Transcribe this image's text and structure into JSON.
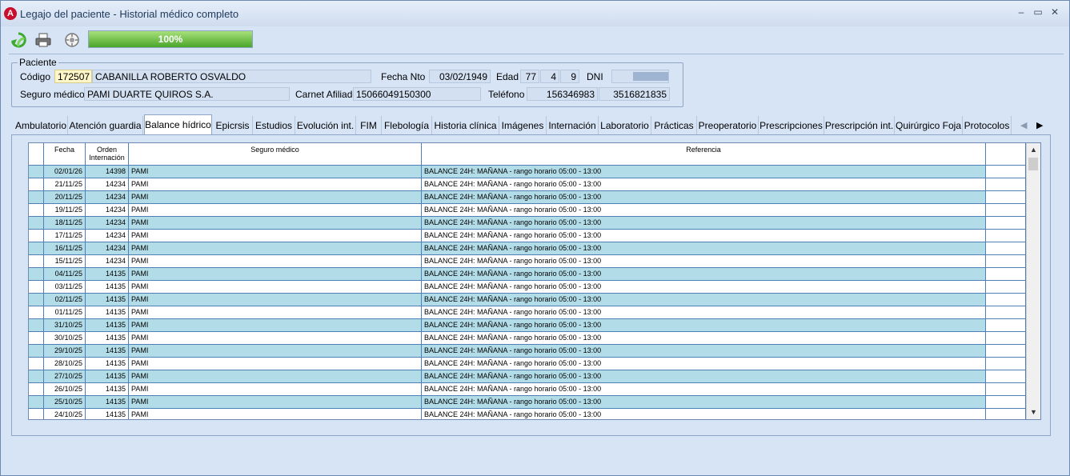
{
  "window": {
    "title": "Legajo del paciente - Historial médico completo",
    "app_icon_letter": "A",
    "minimize": "‒",
    "maximize": "▭",
    "close": "✕"
  },
  "toolbar": {
    "refresh_icon": "refresh-icon",
    "print_icon": "printer-icon",
    "tool_icon": "gear-icon",
    "progress_label": "100%",
    "progress_value": 1.0
  },
  "paciente": {
    "legend": "Paciente",
    "codigo_label": "Código",
    "codigo": "172507",
    "nombre": "CABANILLA ROBERTO OSVALDO",
    "fecha_nto_label": "Fecha Nto",
    "fecha_nto": "03/02/1949",
    "edad_label": "Edad",
    "edad_anios": "77",
    "edad_meses": "4",
    "edad_dias": "9",
    "dni_label": "DNI",
    "seguro_label": "Seguro médico",
    "seguro": "PAMI DUARTE QUIROS S.A.",
    "carnet_label": "Carnet Afiliado",
    "carnet": "15066049150300",
    "telefono_label": "Teléfono",
    "telefono1": "156346983",
    "telefono2": "3516821835"
  },
  "tabs": [
    "Ambulatorio",
    "Atención guardia",
    "Balance hídrico",
    "Epicrsis",
    "Estudios",
    "Evolución int.",
    "FIM",
    "Flebología",
    "Historia clínica",
    "Imágenes",
    "Internación",
    "Laboratorio",
    "Prácticas",
    "Preoperatorio",
    "Prescripciones",
    "Prescripción int.",
    "Quirúrgico Foja",
    "Protocolos"
  ],
  "tab_arrows": {
    "left": "◀",
    "right": "▶"
  },
  "grid": {
    "headers": {
      "fecha": "Fecha",
      "orden": "Orden Internación",
      "seguro": "Seguro médico",
      "referencia": "Referencia"
    },
    "rows": [
      {
        "fecha": "02/01/26",
        "orden": "14398",
        "seguro": "PAMI",
        "referencia": "BALANCE 24H: MAÑANA - rango horario 05:00 - 13:00"
      },
      {
        "fecha": "21/11/25",
        "orden": "14234",
        "seguro": "PAMI",
        "referencia": "BALANCE 24H: MAÑANA - rango horario 05:00 - 13:00"
      },
      {
        "fecha": "20/11/25",
        "orden": "14234",
        "seguro": "PAMI",
        "referencia": "BALANCE 24H: MAÑANA - rango horario 05:00 - 13:00"
      },
      {
        "fecha": "19/11/25",
        "orden": "14234",
        "seguro": "PAMI",
        "referencia": "BALANCE 24H: MAÑANA - rango horario 05:00 - 13:00"
      },
      {
        "fecha": "18/11/25",
        "orden": "14234",
        "seguro": "PAMI",
        "referencia": "BALANCE 24H: MAÑANA - rango horario 05:00 - 13:00"
      },
      {
        "fecha": "17/11/25",
        "orden": "14234",
        "seguro": "PAMI",
        "referencia": "BALANCE 24H: MAÑANA - rango horario 05:00 - 13:00"
      },
      {
        "fecha": "16/11/25",
        "orden": "14234",
        "seguro": "PAMI",
        "referencia": "BALANCE 24H: MAÑANA - rango horario 05:00 - 13:00"
      },
      {
        "fecha": "15/11/25",
        "orden": "14234",
        "seguro": "PAMI",
        "referencia": "BALANCE 24H: MAÑANA - rango horario 05:00 - 13:00"
      },
      {
        "fecha": "04/11/25",
        "orden": "14135",
        "seguro": "PAMI",
        "referencia": "BALANCE 24H: MAÑANA - rango horario 05:00 - 13:00"
      },
      {
        "fecha": "03/11/25",
        "orden": "14135",
        "seguro": "PAMI",
        "referencia": "BALANCE 24H: MAÑANA - rango horario 05:00 - 13:00"
      },
      {
        "fecha": "02/11/25",
        "orden": "14135",
        "seguro": "PAMI",
        "referencia": "BALANCE 24H: MAÑANA - rango horario 05:00 - 13:00"
      },
      {
        "fecha": "01/11/25",
        "orden": "14135",
        "seguro": "PAMI",
        "referencia": "BALANCE 24H: MAÑANA - rango horario 05:00 - 13:00"
      },
      {
        "fecha": "31/10/25",
        "orden": "14135",
        "seguro": "PAMI",
        "referencia": "BALANCE 24H: MAÑANA - rango horario 05:00 - 13:00"
      },
      {
        "fecha": "30/10/25",
        "orden": "14135",
        "seguro": "PAMI",
        "referencia": "BALANCE 24H: MAÑANA - rango horario 05:00 - 13:00"
      },
      {
        "fecha": "29/10/25",
        "orden": "14135",
        "seguro": "PAMI",
        "referencia": "BALANCE 24H: MAÑANA - rango horario 05:00 - 13:00"
      },
      {
        "fecha": "28/10/25",
        "orden": "14135",
        "seguro": "PAMI",
        "referencia": "BALANCE 24H: MAÑANA - rango horario 05:00 - 13:00"
      },
      {
        "fecha": "27/10/25",
        "orden": "14135",
        "seguro": "PAMI",
        "referencia": "BALANCE 24H: MAÑANA - rango horario 05:00 - 13:00"
      },
      {
        "fecha": "26/10/25",
        "orden": "14135",
        "seguro": "PAMI",
        "referencia": "BALANCE 24H: MAÑANA - rango horario 05:00 - 13:00"
      },
      {
        "fecha": "25/10/25",
        "orden": "14135",
        "seguro": "PAMI",
        "referencia": "BALANCE 24H: MAÑANA - rango horario 05:00 - 13:00"
      },
      {
        "fecha": "24/10/25",
        "orden": "14135",
        "seguro": "PAMI",
        "referencia": "BALANCE 24H: MAÑANA - rango horario 05:00 - 13:00"
      }
    ]
  },
  "scroll": {
    "up": "▲",
    "down": "▼"
  },
  "colors": {
    "row_alt": "#b2dde8",
    "codigo_bg": "#fff6c8",
    "accent": "#4aa62a"
  }
}
